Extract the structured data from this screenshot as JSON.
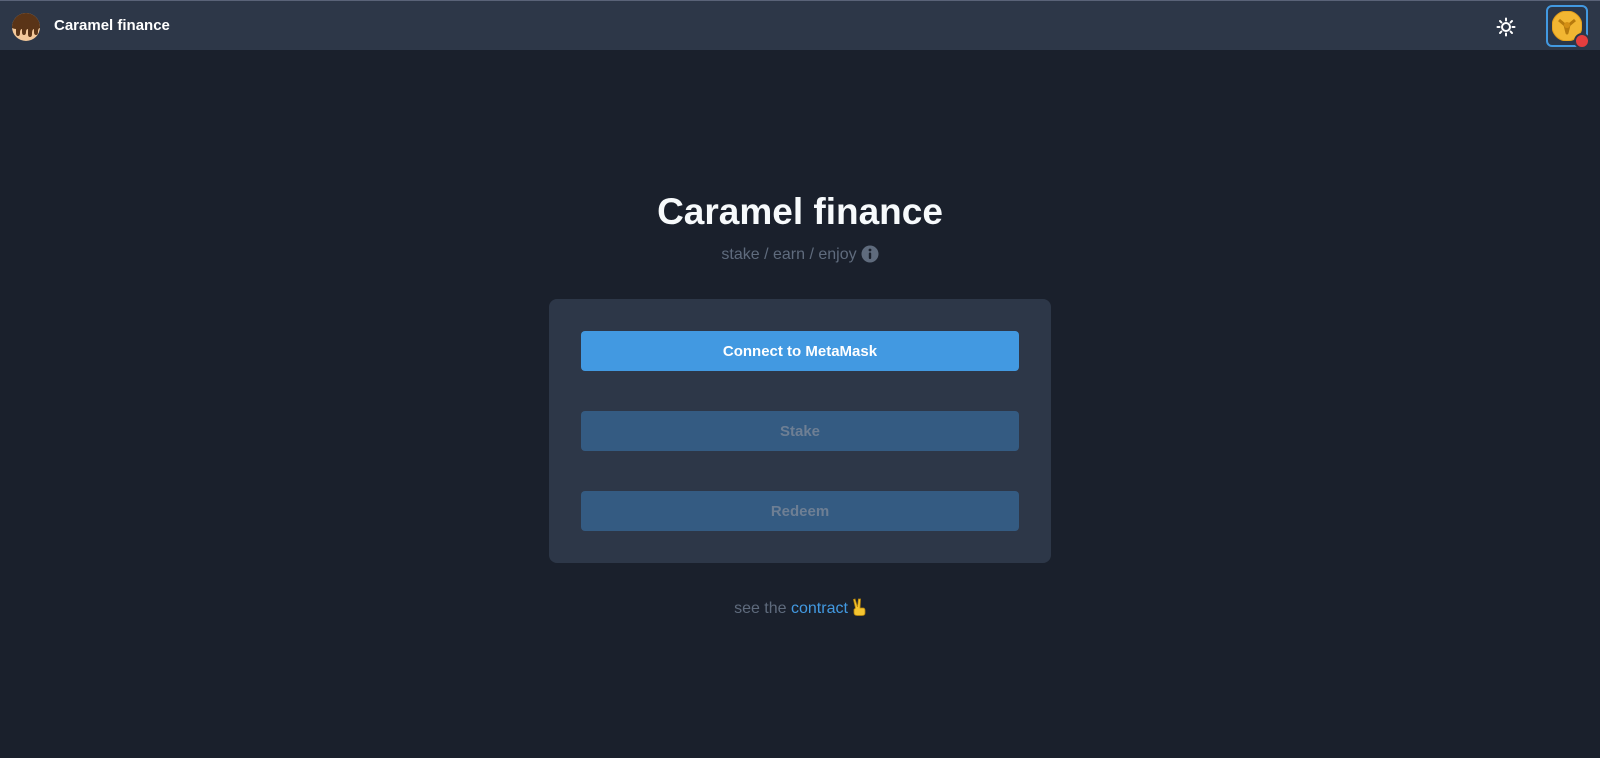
{
  "colors": {
    "page_background": "#1a202c",
    "navbar_background": "#2d3748",
    "card_background": "#2d3748",
    "accent": "#4299e1",
    "disabled_button": "#345b82",
    "disabled_text": "#6e7f94",
    "muted_text": "#5f6b7d",
    "status_dot": "#e53e3e"
  },
  "navbar": {
    "logo_icon": "caramel-drip-icon",
    "brand": "Caramel finance",
    "theme_toggle_icon": "sun-icon",
    "avatar_icon": "wallet-avatar-icon",
    "status": "disconnected"
  },
  "hero": {
    "title": "Caramel finance",
    "tagline": "stake / earn / enjoy",
    "tagline_icon": "info-icon"
  },
  "actions": {
    "connect_label": "Connect to MetaMask",
    "stake_label": "Stake",
    "stake_disabled": true,
    "redeem_label": "Redeem",
    "redeem_disabled": true
  },
  "footer": {
    "prefix": "see the",
    "link_label": "contract",
    "emoji": "✌"
  }
}
